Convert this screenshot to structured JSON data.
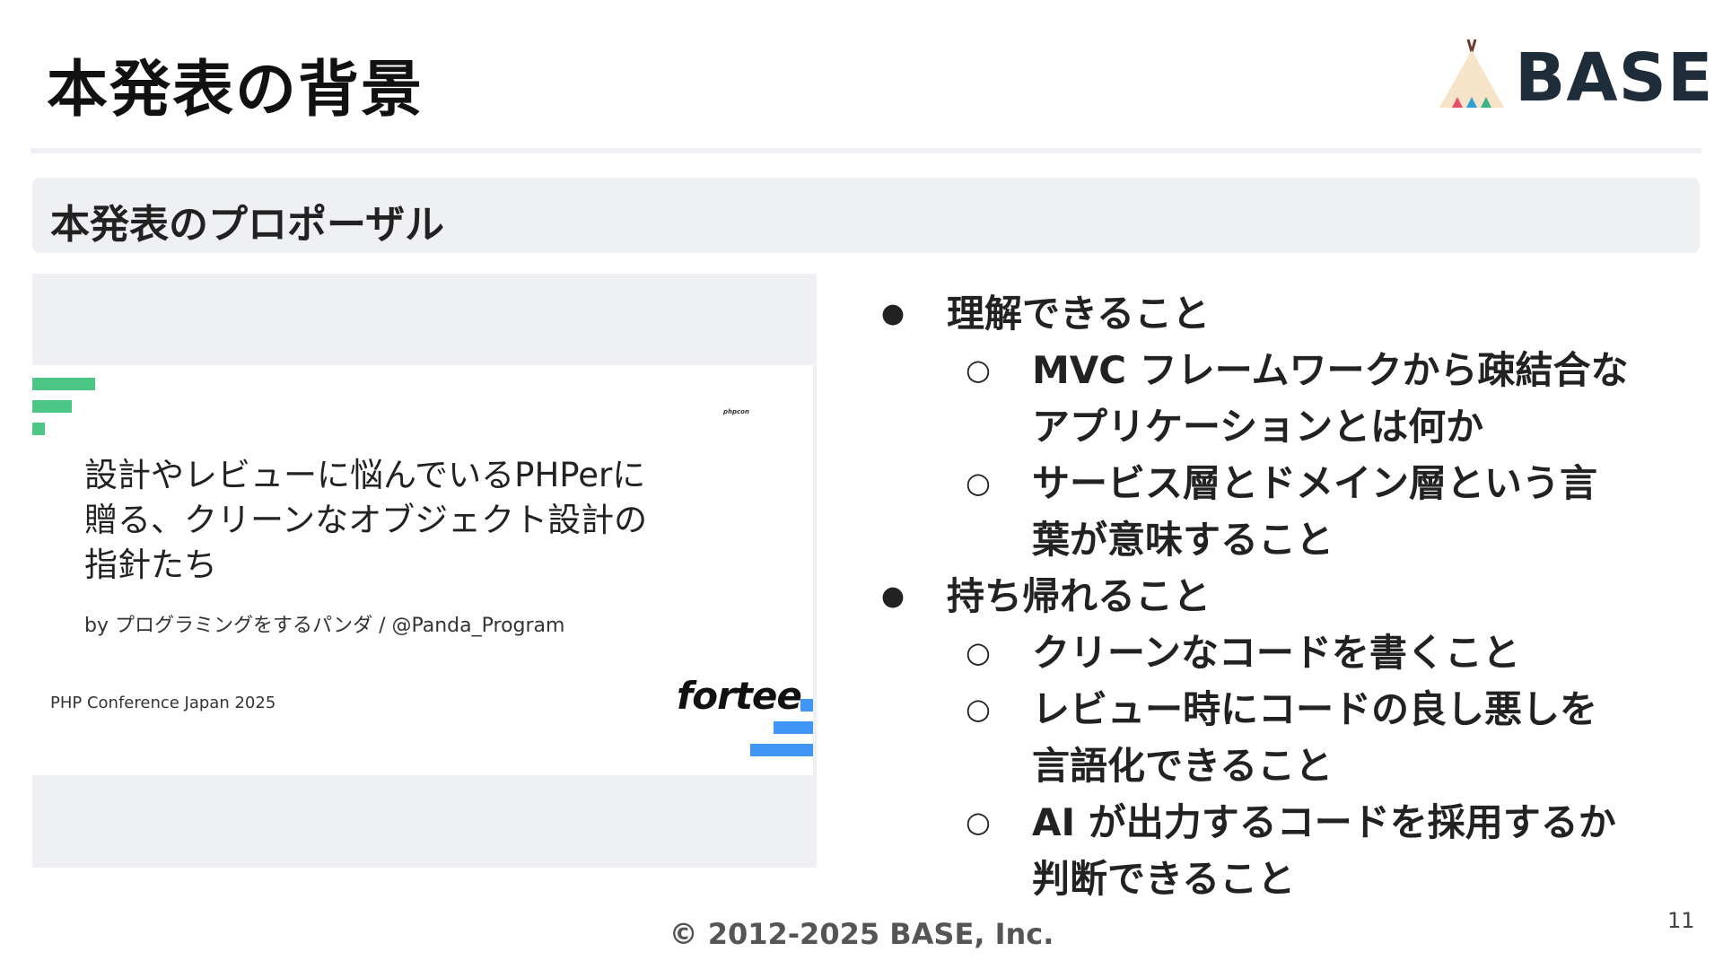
{
  "slide": {
    "title": "本発表の背景",
    "section_label": "本発表のプロポーザル",
    "logo_text": "BASE",
    "footer": "© 2012-2025 BASE, Inc.",
    "page_number": "11"
  },
  "proposal_card": {
    "small_tag": "phpcon",
    "title_lines": [
      "設計やレビューに悩んでいるPHPerに",
      "贈る、クリーンなオブジェクト設計の",
      "指針たち"
    ],
    "author": "by プログラミングをするパンダ / @Panda_Program",
    "conference": "PHP Conference Japan 2025",
    "brand": "fortee"
  },
  "bullets": [
    {
      "level": 1,
      "marker": "●",
      "text": "理解できること"
    },
    {
      "level": 2,
      "marker": "○",
      "text": "MVC フレームワークから疎結合な"
    },
    {
      "level": 2,
      "marker": "",
      "text": "アプリケーションとは何か"
    },
    {
      "level": 2,
      "marker": "○",
      "text": "サービス層とドメイン層という言"
    },
    {
      "level": 2,
      "marker": "",
      "text": "葉が意味すること"
    },
    {
      "level": 1,
      "marker": "●",
      "text": "持ち帰れること"
    },
    {
      "level": 2,
      "marker": "○",
      "text": "クリーンなコードを書くこと"
    },
    {
      "level": 2,
      "marker": "○",
      "text": "レビュー時にコードの良し悪しを"
    },
    {
      "level": 2,
      "marker": "",
      "text": "言語化できること"
    },
    {
      "level": 2,
      "marker": "○",
      "text": "AI が出力するコードを採用するか"
    },
    {
      "level": 2,
      "marker": "",
      "text": "判断できること"
    }
  ],
  "colors": {
    "accent_green": "#4cc785",
    "accent_blue": "#3f96f4",
    "logo_dark": "#1f2d3a"
  }
}
